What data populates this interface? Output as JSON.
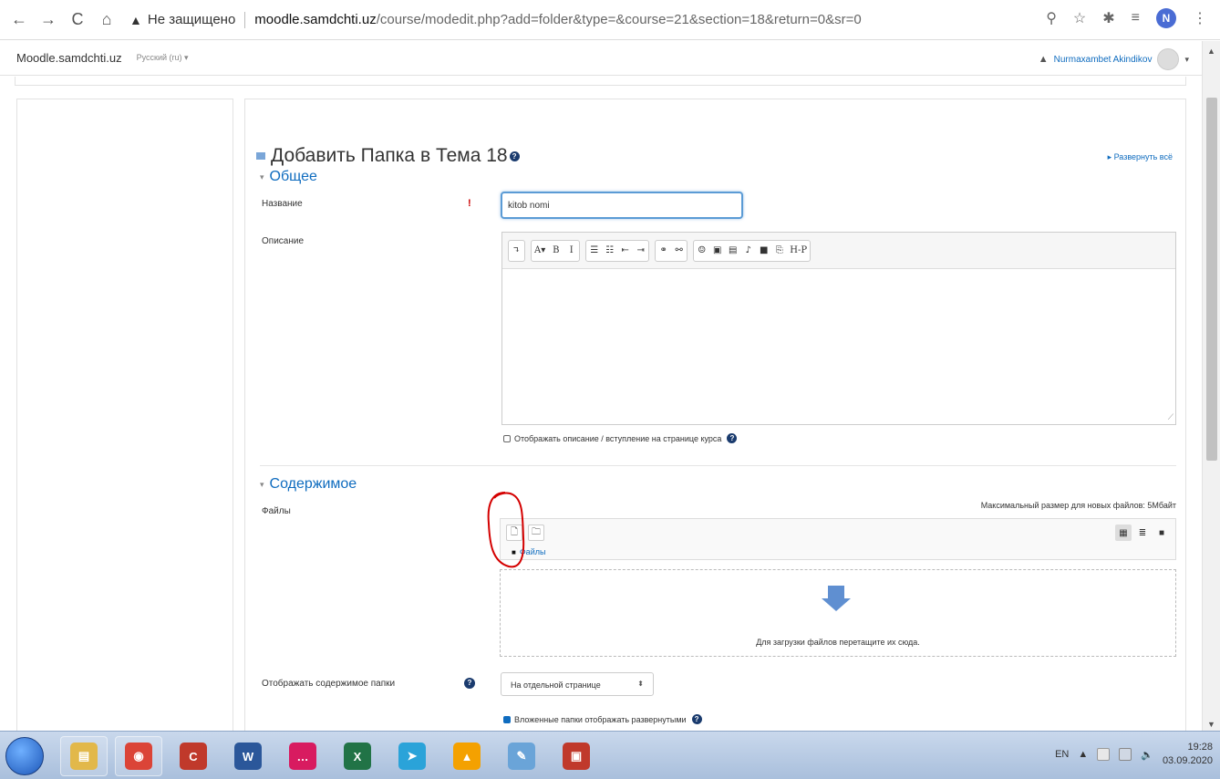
{
  "browser": {
    "back": "←",
    "forward": "→",
    "reload": "C",
    "home": "⌂",
    "warning_icon": "▲",
    "security_label": "Не защищено",
    "domain": "moodle.samdchti.uz",
    "path": "/course/modedit.php?add=folder&type=&course=21&section=18&return=0&sr=0",
    "profile_initial": "N"
  },
  "topnav": {
    "site_name": "Moodle.samdchti.uz",
    "language": "Русский (ru) ▾",
    "user_name": "Nurmaxambet Akindikov"
  },
  "page": {
    "title": "Добавить Папка в Тема 18",
    "expand_all": "▸ Развернуть всё"
  },
  "general": {
    "heading": "Общее",
    "name_label": "Название",
    "name_value": "kitob nomi",
    "description_label": "Описание",
    "show_description_label": "Отображать описание / вступление на странице курса"
  },
  "editor_toolbar": [
    [
      "↴"
    ],
    [
      "A▾",
      "B",
      "I"
    ],
    [
      "☰",
      "☷",
      "⇤",
      "⇥"
    ],
    [
      "⚭",
      "⚯"
    ],
    [
      "☺",
      "▣",
      "▤",
      "♪",
      "■",
      "⎘",
      "H-P"
    ]
  ],
  "content": {
    "heading": "Содержимое",
    "files_label": "Файлы",
    "max_size": "Максимальный размер для новых файлов: 5Мбайт",
    "path_label": "Файлы",
    "drop_text": "Для загрузки файлов перетащите их сюда.",
    "display_label": "Отображать содержимое папки",
    "display_value": "На отдельной странице",
    "subfolders_label": "Вложенные папки отображать развернутыми"
  },
  "taskbar": {
    "language": "EN",
    "time": "19:28",
    "date": "03.09.2020",
    "apps": [
      {
        "name": "explorer",
        "color": "#e2b84a",
        "glyph": "▤"
      },
      {
        "name": "chrome",
        "color": "#db4437",
        "glyph": "◉"
      },
      {
        "name": "ccleaner",
        "color": "#c0392b",
        "glyph": "C"
      },
      {
        "name": "word",
        "color": "#2b579a",
        "glyph": "W"
      },
      {
        "name": "chat",
        "color": "#d81b60",
        "glyph": "…"
      },
      {
        "name": "excel",
        "color": "#217346",
        "glyph": "X"
      },
      {
        "name": "telegram",
        "color": "#2aa3d9",
        "glyph": "➤"
      },
      {
        "name": "avast",
        "color": "#f4a100",
        "glyph": "▲"
      },
      {
        "name": "paint",
        "color": "#6aa4d8",
        "glyph": "✎"
      },
      {
        "name": "image-viewer",
        "color": "#c0392b",
        "glyph": "▣"
      }
    ]
  },
  "colors": {
    "link": "#0f6cbf",
    "required": "#cc0000",
    "annotation": "#d40000"
  }
}
